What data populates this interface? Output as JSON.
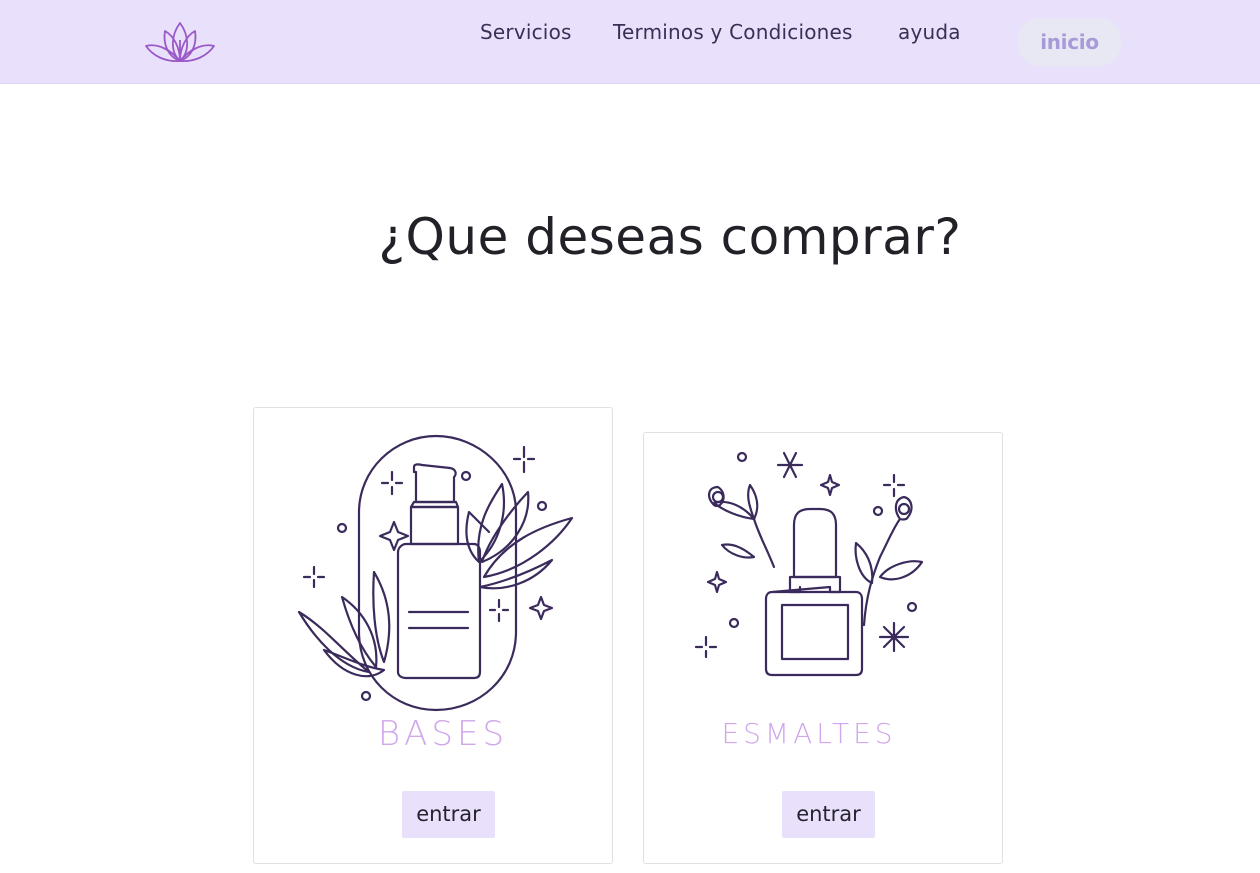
{
  "header": {
    "nav": {
      "servicios": "Servicios",
      "terminos": "Terminos y Condiciones",
      "ayuda": "ayuda"
    },
    "inicio_label": "inicio"
  },
  "main": {
    "title": "¿Que deseas comprar?",
    "cards": [
      {
        "label": "BASES",
        "button": "entrar",
        "icon": "serum-bottle-icon"
      },
      {
        "label": "ESMALTES",
        "button": "entrar",
        "icon": "nail-polish-icon"
      }
    ]
  },
  "colors": {
    "navbar_bg": "#e9e1fb",
    "button_bg": "#e9e1fb",
    "label_color": "#cfa7ea",
    "logo_color": "#9b59c7",
    "line_art": "#3b2b5c"
  }
}
